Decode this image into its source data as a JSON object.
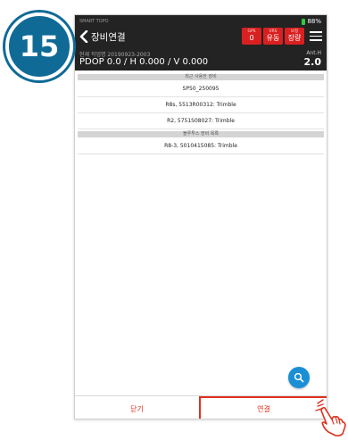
{
  "step_number": "15",
  "status_bar": {
    "app_name": "SMART TOPO",
    "battery": "88%"
  },
  "header": {
    "title": "장비연결",
    "badges": [
      {
        "label": "GPS",
        "value": "0"
      },
      {
        "label": "VRS",
        "value": "유동"
      },
      {
        "label": "보정",
        "value": "장량"
      }
    ],
    "job_label": "현재 작업명 20190923-2003",
    "dop": "PDOP 0.0 / H 0.000 / V 0.000",
    "anth_label": "Ant.H",
    "anth_value": "2.0"
  },
  "recent_section": {
    "title": "최근 사용한 장비",
    "items": [
      "SP50_250095"
    ]
  },
  "devices_section": {
    "items": [
      "R8s, 5513R00312: Trimble",
      "R2, 5751S08027: Trimble"
    ]
  },
  "bluetooth_section": {
    "title": "블루투스 장비 목록",
    "items": [
      "R8-3, 5010415085: Trimble"
    ]
  },
  "footer": {
    "close_label": "닫기",
    "connect_label": "연결"
  },
  "colors": {
    "accent_red": "#e0301e",
    "header_bg": "#232323",
    "badge_blue": "#0f6a96",
    "fab_blue": "#1a8fd6"
  },
  "icons": {
    "back": "chevron-left-icon",
    "menu": "hamburger-menu-icon",
    "search": "search-icon",
    "pointer": "hand-pointer-icon"
  }
}
